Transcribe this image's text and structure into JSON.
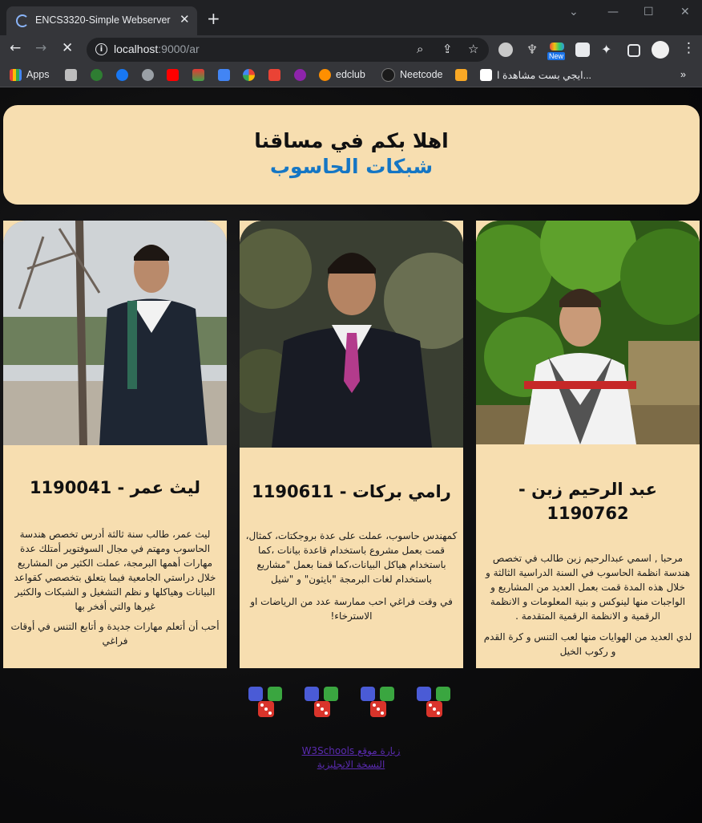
{
  "browser": {
    "tab_title": "ENCS3320-Simple Webserver",
    "url_host": "localhost",
    "url_rest": ":9000/ar",
    "bookmarks": [
      "Apps",
      "edclub",
      "Neetcode",
      "ايجي بست مشاهدة ا..."
    ],
    "new_badge": "New"
  },
  "header": {
    "title": "اهلا بكم في مساقنا",
    "subtitle": "شبكات الحاسوب"
  },
  "cards": [
    {
      "name": "عبد الرحيم زبن - 1190762",
      "paragraphs": [
        "مرحبا , اسمي عبدالرحيم زبن طالب في تخصص هندسة انظمة الحاسوب في السنة الدراسية الثالثة و خلال هذه المدة قمت بعمل العديد من المشاريع و الواجبات منها لينوكس و بنية المعلومات و الانظمة الرقمية و الانظمة الرقمية المتقدمة .",
        "لدي العديد من الهوايات منها لعب التنس و كرة القدم و ركوب الخيل"
      ]
    },
    {
      "name": "رامي بركات - 1190611",
      "paragraphs": [
        "كمهندس حاسوب، عملت على عدة بروجكتات، كمثال، قمت بعمل مشروع باستخدام قاعدة بيانات ،كما باستخدام هياكل البيانات،كما قمنا بعمل \"مشاريع باستخدام لغات البرمجة \"بايثون\" و \"شيل",
        "في وقت فراغي احب ممارسة عدد من الرياضات او الاسترخاء!"
      ]
    },
    {
      "name": "ليث عمر - 1190041",
      "paragraphs": [
        "ليث عمر، طالب سنة ثالثة أدرس تخصص هندسة الحاسوب ومهتم في مجال السوفتوير أمتلك عدة مهارات أهمها البرمجة، عملت الكثير من المشاريع خلال دراستي الجامعية فيما يتعلق بتخصصي كقواعد البيانات وهياكلها و نظم التشغيل و الشبكات والكثير غيرها والتي أفخر بها",
        "أحب أن أتعلم مهارات جديدة و أتابع التنس في أوقات فراغي"
      ]
    }
  ],
  "links": {
    "w3schools": "زيارة موقع W3Schools",
    "english": "النسخة الانجليزية"
  }
}
